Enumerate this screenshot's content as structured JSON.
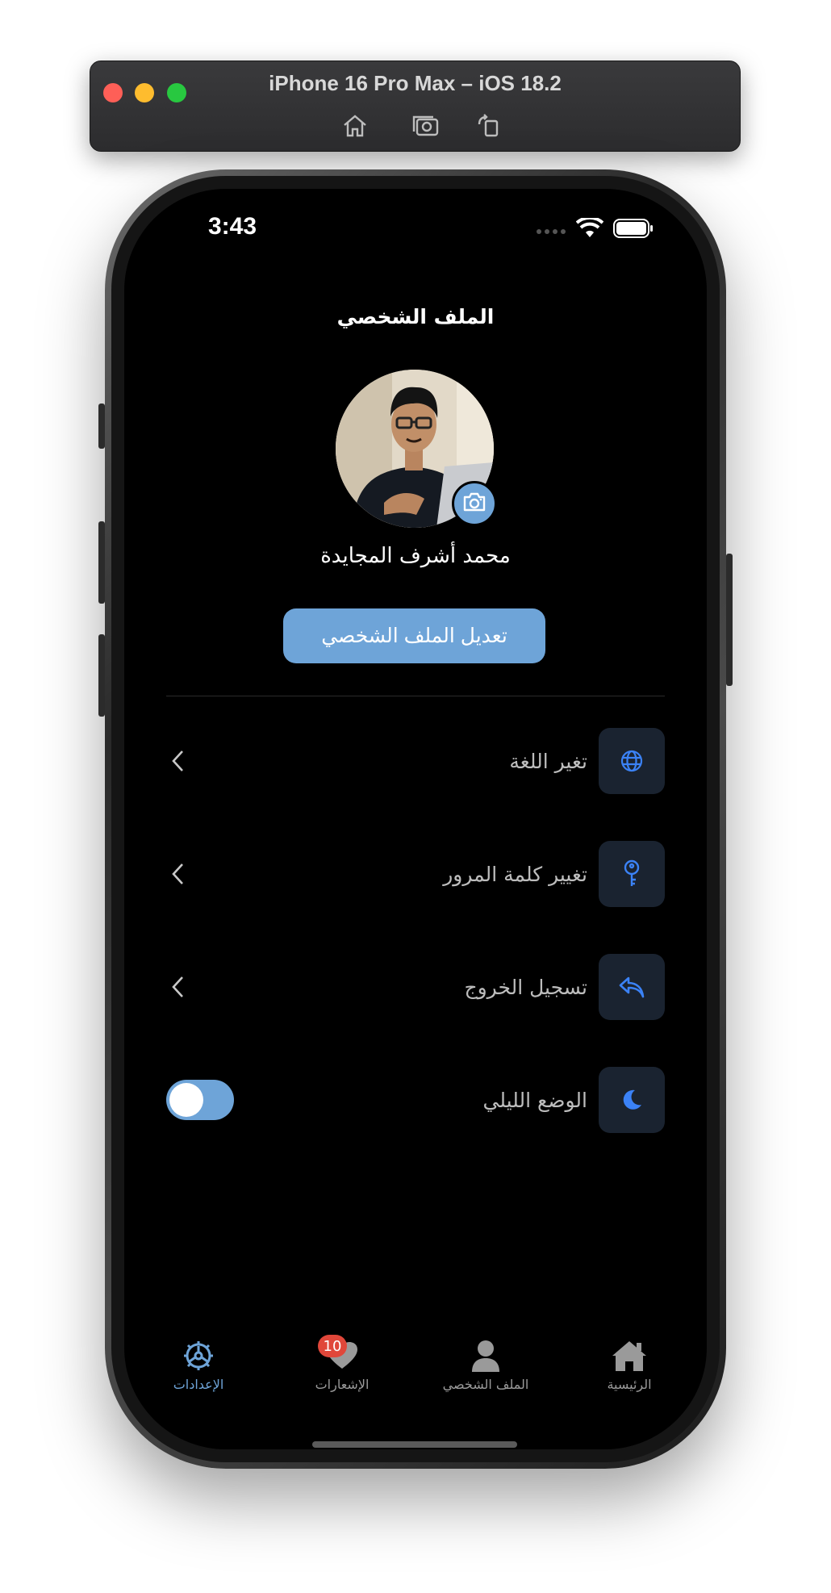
{
  "simulator": {
    "title": "iPhone 16 Pro Max – iOS 18.2"
  },
  "status_bar": {
    "time": "3:43"
  },
  "profile": {
    "page_title": "الملف الشخصي",
    "user_name": "محمد أشرف المجايدة",
    "edit_button": "تعديل الملف الشخصي"
  },
  "settings": {
    "items": [
      {
        "label": "تغير اللغة",
        "icon": "globe-icon"
      },
      {
        "label": "تغيير كلمة المرور",
        "icon": "key-icon"
      },
      {
        "label": "تسجيل الخروج",
        "icon": "logout-icon"
      },
      {
        "label": "الوضع الليلي",
        "icon": "moon-icon",
        "toggle_on": true
      }
    ]
  },
  "tab_bar": {
    "tabs": [
      {
        "label": "الرئيسية",
        "icon": "home-icon"
      },
      {
        "label": "الملف الشخصي",
        "icon": "person-icon"
      },
      {
        "label": "الإشعارات",
        "icon": "heart-icon",
        "badge": "10"
      },
      {
        "label": "الإعدادات",
        "icon": "settings-gear-icon",
        "active": true
      }
    ]
  },
  "colors": {
    "accent": "#6ea4d8",
    "icon_blue": "#3b82f6",
    "badge_red": "#e0473a"
  }
}
